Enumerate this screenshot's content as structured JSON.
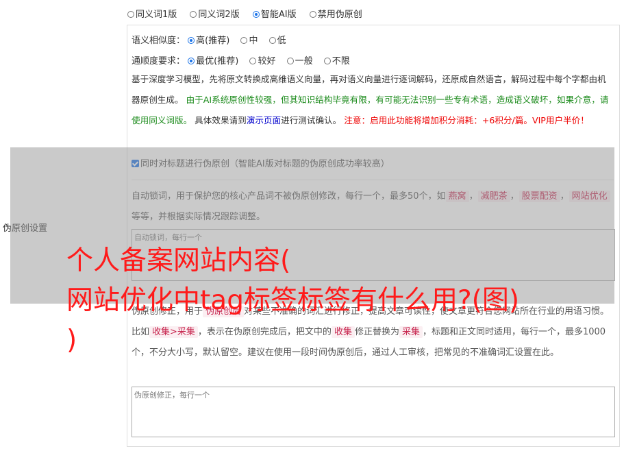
{
  "version_options": [
    {
      "label": "同义词1版",
      "selected": false
    },
    {
      "label": "同义词2版",
      "selected": false
    },
    {
      "label": "智能AI版",
      "selected": true
    },
    {
      "label": "禁用伪原创",
      "selected": false
    }
  ],
  "similarity": {
    "label": "语义相似度：",
    "options": [
      {
        "label": "高(推荐)",
        "selected": true
      },
      {
        "label": "中",
        "selected": false
      },
      {
        "label": "低",
        "selected": false
      }
    ]
  },
  "fluency": {
    "label": "通顺度要求：",
    "options": [
      {
        "label": "最优(推荐)",
        "selected": true
      },
      {
        "label": "较好",
        "selected": false
      },
      {
        "label": "一般",
        "selected": false
      },
      {
        "label": "不限",
        "selected": false
      }
    ]
  },
  "description": {
    "part1": "基于深度学习模型，先将原文转换成高维语义向量，再对语义向量进行逐词解码，还原成自然语言，解码过程中每个字都由机器原创生成。",
    "part2_green": "由于AI系统原创性较强，但其知识结构毕竟有限，有可能无法识别一些专有术语，造成语义破坏，如果介意，请使用同义词版。",
    "part3": "具体效果请到",
    "link": "演示页面",
    "part4": "进行测试确认。",
    "part5_red": "注意：启用此功能将增加积分消耗：+6积分/篇。VIP用户半价！"
  },
  "title_checkbox": {
    "label": "同时对标题进行伪原创（智能AI版对标题的伪原创成功率较高）",
    "checked": true
  },
  "side_label": "伪原创设置",
  "lock_words": {
    "desc_a": "自动锁词，用于保护您的核心产品词不被伪原创修改，每行一个，最多50个，如",
    "tags": [
      "燕窝",
      "减肥茶",
      "股票配资",
      "网站优化"
    ],
    "desc_b": "等等，并根据实际情况跟踪调整。",
    "placeholder": "自动锁词，每行一个"
  },
  "correction": {
    "desc_a": "伪原创修正，用于",
    "tag1": "伪原创后",
    "desc_b": "对某些不准确的词汇进行修正，提高文章可读性，使文章更符合您网站所在行业的用语习惯。比如",
    "tag2": "收集>采集",
    "desc_c": "，表示在伪原创完成后，把文中的",
    "tag3": "收集",
    "desc_d": "修正替换为",
    "tag4": "采集",
    "desc_e": "，标题和正文同时适用，每行一个，最多1000个，不分大小写，默认留空。建议在使用一段时间伪原创后，通过人工审核，把常见的不准确词汇设置在此。",
    "placeholder": "伪原创修正，每行一个"
  },
  "headline": {
    "line1": "个人备案网站内容(",
    "line2": "网站优化中tag标签标签有什么用?(图)",
    "line3": ")"
  }
}
